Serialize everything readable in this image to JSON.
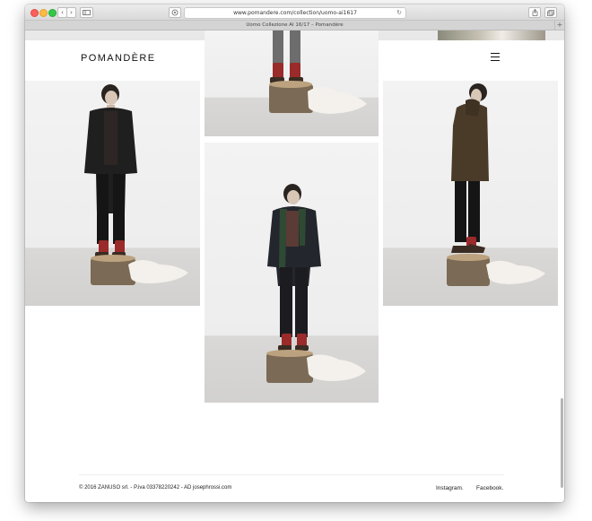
{
  "browser": {
    "url": "www.pomandere.com/collection/uomo-ai1617",
    "tab_title": "Uomo Collezione AI 16/17 – Pomandère",
    "new_tab": "+",
    "reload_glyph": "↻",
    "back_glyph": "‹",
    "forward_glyph": "›"
  },
  "header": {
    "logo": "POMANDÈRE",
    "menu_icon": "hamburger-icon"
  },
  "gallery": {
    "photos": [
      {
        "name": "photo-left",
        "subject": "model-dark-coat"
      },
      {
        "name": "photo-center-top",
        "subject": "model-red-boots-crop"
      },
      {
        "name": "photo-center",
        "subject": "model-green-scarf"
      },
      {
        "name": "photo-right",
        "subject": "model-brown-parka"
      }
    ]
  },
  "footer": {
    "copyright": "© 2016 ZANUSO srl. - P.iva 03378220242 - AD josephrossi.com",
    "instagram": "Instagram.",
    "facebook": "Facebook."
  },
  "colors": {
    "boots": "#9b2a2a",
    "coat_dark": "#1e1e1e",
    "parka_brown": "#4a3b29",
    "scarf_green": "#2f4a34"
  }
}
